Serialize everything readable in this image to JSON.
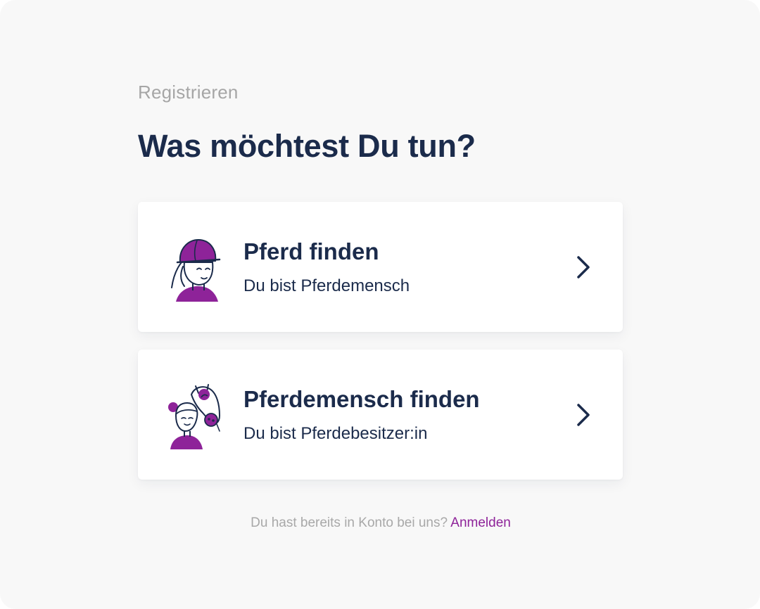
{
  "header": {
    "step_label": "Registrieren",
    "title": "Was möchtest Du tun?"
  },
  "options": [
    {
      "title": "Pferd finden",
      "subtitle": "Du bist Pferdemensch",
      "illustration": "rider-with-helmet-icon",
      "action_icon": "chevron-right-icon"
    },
    {
      "title": "Pferdemensch finden",
      "subtitle": "Du bist Pferdebesitzer:in",
      "illustration": "person-with-horse-icon",
      "action_icon": "chevron-right-icon"
    }
  ],
  "footer": {
    "prompt": "Du hast bereits in Konto bei uns?",
    "login_link": "Anmelden"
  },
  "colors": {
    "background": "#f8f8f8",
    "card": "#ffffff",
    "heading": "#1b2b4b",
    "muted": "#a6a6a6",
    "accent": "#8e2399"
  }
}
